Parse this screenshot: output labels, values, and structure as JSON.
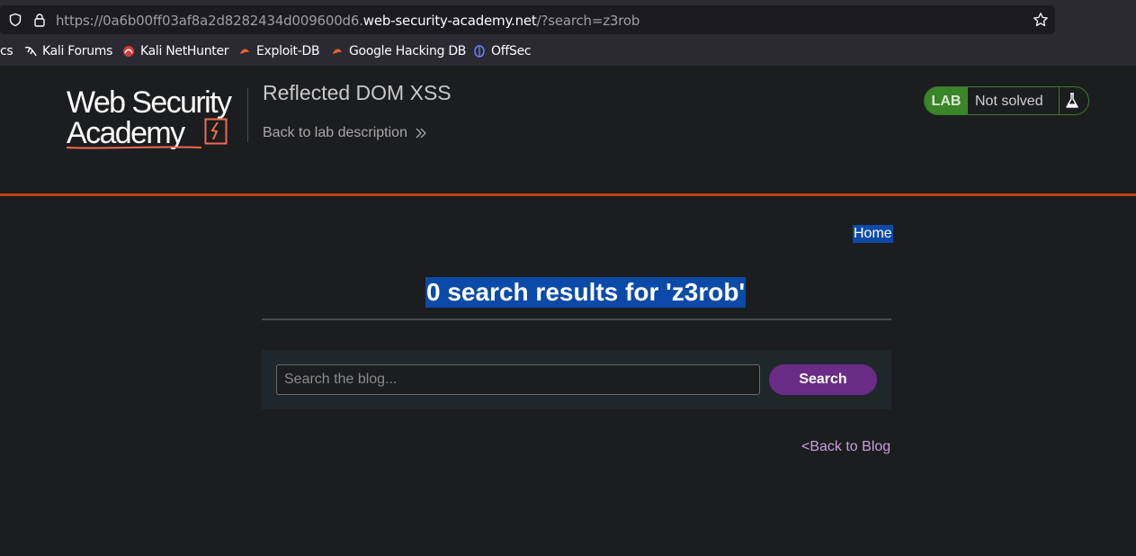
{
  "browser": {
    "url_prefix": "https://0a6b00ff03af8a2d8282434d009600d6.",
    "url_domain": "web-security-academy.net",
    "url_suffix": "/?search=z3rob",
    "bookmarks": [
      {
        "label": "cs",
        "icon": "none"
      },
      {
        "label": "Kali Forums",
        "icon": "kali-dragon-icon"
      },
      {
        "label": "Kali NetHunter",
        "icon": "nethunter-icon"
      },
      {
        "label": "Exploit-DB",
        "icon": "exploitdb-icon"
      },
      {
        "label": "Google Hacking DB",
        "icon": "ghdb-icon"
      },
      {
        "label": "OffSec",
        "icon": "offsec-icon"
      }
    ]
  },
  "lab": {
    "logo_line1": "Web Security",
    "logo_line2": "Academy",
    "title": "Reflected DOM XSS",
    "back_description": "Back to lab description",
    "badge_label": "LAB",
    "status": "Not solved"
  },
  "main": {
    "home_link": "Home",
    "results_heading": "0 search results for 'z3rob'",
    "search_placeholder": "Search the blog...",
    "search_button": "Search",
    "back_to_blog": "<Back to Blog"
  },
  "colors": {
    "accent_orange": "#c2410c",
    "lab_green": "#3b8529",
    "button_purple": "#6a2c86",
    "link_purple": "#c79fe0",
    "selection_blue": "#0b4aa8"
  }
}
